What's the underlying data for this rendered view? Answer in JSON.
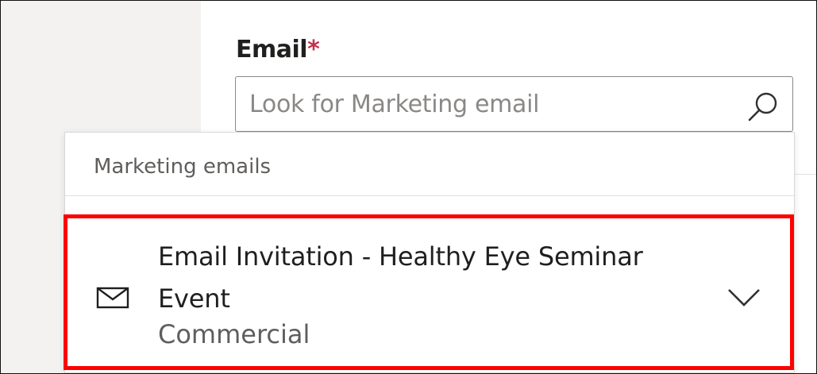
{
  "email_field": {
    "label": "Email",
    "required_marker": "*",
    "search_placeholder": "Look for Marketing email"
  },
  "dropdown": {
    "header": "Marketing emails",
    "results": [
      {
        "title": "Email Invitation - Healthy Eye Seminar Event",
        "subtitle": "Commercial",
        "icon": "mail-icon",
        "expand_icon": "chevron-down-icon"
      }
    ]
  },
  "colors": {
    "required": "#c4314b",
    "highlight_border": "#ff0000",
    "left_panel": "#f3f2f1"
  }
}
